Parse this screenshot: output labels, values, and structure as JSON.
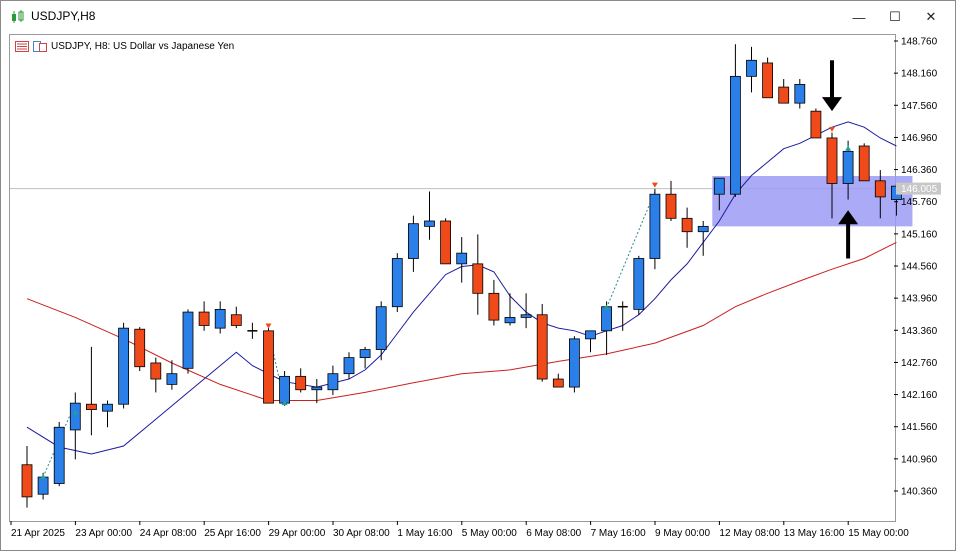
{
  "window": {
    "title": "USDJPY,H8"
  },
  "controls": {
    "minimize": "—",
    "maximize": "☐",
    "close": "✕"
  },
  "chart_header": {
    "label": "USDJPY, H8:  US Dollar vs Japanese Yen"
  },
  "colors": {
    "bull": "#2a7fe8",
    "bear": "#f04a1a",
    "ma_fast": "#1c1ca0",
    "ma_slow": "#cc1f1f",
    "zone": "#9b9bf5",
    "bid_line": "#bfbfbf"
  },
  "chart_data": {
    "type": "candlestick",
    "symbol": "USDJPY",
    "timeframe": "H8",
    "ylim": [
      139.85,
      148.9
    ],
    "y_ticks": [
      "148.760",
      "148.160",
      "147.560",
      "146.960",
      "146.360",
      "145.760",
      "145.160",
      "144.560",
      "143.960",
      "143.360",
      "142.760",
      "142.160",
      "141.560",
      "140.960",
      "140.360"
    ],
    "x_ticks": [
      {
        "label": "21 Apr 2025",
        "index": 0
      },
      {
        "label": "23 Apr 00:00",
        "index": 4
      },
      {
        "label": "24 Apr 08:00",
        "index": 8
      },
      {
        "label": "25 Apr 16:00",
        "index": 12
      },
      {
        "label": "29 Apr 00:00",
        "index": 16
      },
      {
        "label": "30 Apr 08:00",
        "index": 20
      },
      {
        "label": "1 May 16:00",
        "index": 24
      },
      {
        "label": "5 May 00:00",
        "index": 28
      },
      {
        "label": "6 May 08:00",
        "index": 32
      },
      {
        "label": "7 May 16:00",
        "index": 36
      },
      {
        "label": "9 May 00:00",
        "index": 40
      },
      {
        "label": "12 May 08:00",
        "index": 44
      },
      {
        "label": "13 May 16:00",
        "index": 48
      },
      {
        "label": "15 May 00:00",
        "index": 52
      }
    ],
    "current_price": "146.005",
    "candles": [
      [
        140.85,
        141.2,
        140.05,
        140.25
      ],
      [
        140.3,
        140.7,
        140.2,
        140.62
      ],
      [
        140.5,
        141.65,
        140.45,
        141.55
      ],
      [
        141.5,
        142.2,
        140.95,
        142.0
      ],
      [
        141.98,
        143.05,
        141.4,
        141.88
      ],
      [
        141.85,
        142.05,
        141.55,
        141.98
      ],
      [
        141.98,
        143.5,
        141.9,
        143.4
      ],
      [
        143.38,
        143.42,
        142.6,
        142.68
      ],
      [
        142.75,
        142.85,
        142.2,
        142.45
      ],
      [
        142.35,
        142.8,
        142.25,
        142.55
      ],
      [
        142.65,
        143.75,
        142.55,
        143.7
      ],
      [
        143.7,
        143.9,
        143.35,
        143.45
      ],
      [
        143.4,
        143.9,
        143.3,
        143.75
      ],
      [
        143.65,
        143.8,
        143.4,
        143.45
      ],
      [
        143.35,
        143.5,
        143.2,
        143.35
      ],
      [
        143.35,
        143.4,
        142.0,
        142.0
      ],
      [
        142.0,
        142.6,
        141.95,
        142.5
      ],
      [
        142.5,
        142.65,
        142.2,
        142.25
      ],
      [
        142.25,
        142.45,
        142.0,
        142.3
      ],
      [
        142.25,
        142.7,
        142.15,
        142.55
      ],
      [
        142.55,
        142.95,
        142.45,
        142.85
      ],
      [
        142.85,
        143.05,
        142.65,
        143.0
      ],
      [
        143.0,
        143.9,
        142.8,
        143.8
      ],
      [
        143.8,
        144.8,
        143.7,
        144.7
      ],
      [
        144.7,
        145.5,
        144.45,
        145.35
      ],
      [
        145.3,
        145.95,
        145.05,
        145.4
      ],
      [
        145.4,
        145.45,
        144.6,
        144.6
      ],
      [
        144.6,
        145.1,
        144.25,
        144.8
      ],
      [
        144.6,
        145.15,
        143.65,
        144.05
      ],
      [
        144.05,
        144.3,
        143.45,
        143.55
      ],
      [
        143.5,
        144.05,
        143.45,
        143.6
      ],
      [
        143.6,
        144.05,
        143.4,
        143.65
      ],
      [
        143.65,
        143.85,
        142.4,
        142.45
      ],
      [
        142.45,
        142.55,
        142.3,
        142.3
      ],
      [
        142.3,
        143.25,
        142.2,
        143.2
      ],
      [
        143.2,
        143.35,
        142.95,
        143.35
      ],
      [
        143.35,
        143.9,
        142.9,
        143.8
      ],
      [
        143.8,
        143.9,
        143.35,
        143.8
      ],
      [
        143.75,
        144.75,
        143.65,
        144.7
      ],
      [
        144.7,
        146.0,
        144.5,
        145.9
      ],
      [
        145.9,
        146.15,
        145.4,
        145.45
      ],
      [
        145.45,
        145.65,
        144.9,
        145.2
      ],
      [
        145.2,
        145.4,
        144.75,
        145.3
      ],
      [
        145.9,
        146.1,
        145.6,
        146.2
      ],
      [
        145.9,
        148.7,
        145.85,
        148.1
      ],
      [
        148.1,
        148.65,
        147.8,
        148.4
      ],
      [
        148.35,
        148.45,
        147.7,
        147.7
      ],
      [
        147.9,
        148.05,
        147.6,
        147.6
      ],
      [
        147.6,
        148.05,
        147.5,
        147.95
      ],
      [
        147.45,
        147.5,
        146.95,
        146.95
      ],
      [
        146.95,
        147.05,
        145.45,
        146.1
      ],
      [
        146.1,
        146.9,
        145.8,
        146.7
      ],
      [
        146.8,
        146.85,
        146.15,
        146.15
      ],
      [
        146.15,
        146.35,
        145.45,
        145.85
      ],
      [
        145.8,
        146.1,
        145.5,
        146.05
      ]
    ],
    "ma_fast": [
      [
        0,
        141.55
      ],
      [
        2,
        141.18
      ],
      [
        4,
        141.05
      ],
      [
        6,
        141.2
      ],
      [
        8,
        141.7
      ],
      [
        10,
        142.2
      ],
      [
        12,
        142.7
      ],
      [
        13,
        142.95
      ],
      [
        14,
        142.7
      ],
      [
        16,
        142.4
      ],
      [
        18,
        142.3
      ],
      [
        20,
        142.45
      ],
      [
        21,
        142.62
      ],
      [
        22,
        142.9
      ],
      [
        23,
        143.3
      ],
      [
        24,
        143.7
      ],
      [
        25,
        144.05
      ],
      [
        26,
        144.4
      ],
      [
        27,
        144.55
      ],
      [
        28,
        144.58
      ],
      [
        29,
        144.45
      ],
      [
        30,
        144.0
      ],
      [
        31,
        143.7
      ],
      [
        32,
        143.5
      ],
      [
        33,
        143.4
      ],
      [
        34,
        143.35
      ],
      [
        35,
        143.25
      ],
      [
        36,
        143.35
      ],
      [
        37,
        143.45
      ],
      [
        38,
        143.65
      ],
      [
        39,
        143.95
      ],
      [
        40,
        144.3
      ],
      [
        41,
        144.6
      ],
      [
        42,
        145.0
      ],
      [
        43,
        145.4
      ],
      [
        44,
        145.9
      ],
      [
        45,
        146.25
      ],
      [
        46,
        146.5
      ],
      [
        47,
        146.75
      ],
      [
        48,
        146.85
      ],
      [
        49,
        147.0
      ],
      [
        50,
        147.15
      ],
      [
        51,
        147.25
      ],
      [
        52,
        147.15
      ],
      [
        53,
        146.95
      ],
      [
        54,
        146.8
      ]
    ],
    "ma_slow": [
      [
        0,
        143.95
      ],
      [
        3,
        143.6
      ],
      [
        6,
        143.2
      ],
      [
        9,
        142.75
      ],
      [
        12,
        142.35
      ],
      [
        15,
        142.05
      ],
      [
        18,
        142.05
      ],
      [
        21,
        142.2
      ],
      [
        24,
        142.38
      ],
      [
        27,
        142.55
      ],
      [
        30,
        142.62
      ],
      [
        33,
        142.78
      ],
      [
        36,
        142.92
      ],
      [
        39,
        143.12
      ],
      [
        42,
        143.45
      ],
      [
        44,
        143.8
      ],
      [
        46,
        144.05
      ],
      [
        48,
        144.28
      ],
      [
        50,
        144.5
      ],
      [
        52,
        144.7
      ],
      [
        54,
        145.0
      ]
    ],
    "zone": {
      "from_index": 43,
      "to_index": 54.5,
      "top": 146.24,
      "bottom": 145.3
    },
    "dotted_connectors": [
      {
        "from": [
          1,
          140.62
        ],
        "to": [
          3,
          142.0
        ]
      },
      {
        "from": [
          15,
          143.35
        ],
        "to": [
          16,
          142.0
        ]
      },
      {
        "from": [
          36,
          143.78
        ],
        "to": [
          39,
          145.95
        ]
      }
    ],
    "signal_markers": [
      {
        "index": 1,
        "price": 140.62,
        "kind": "buy"
      },
      {
        "index": 3,
        "price": 141.82,
        "kind": "buy"
      },
      {
        "index": 15,
        "price": 143.45,
        "kind": "sell"
      },
      {
        "index": 16,
        "price": 142.0,
        "kind": "buy"
      },
      {
        "index": 36,
        "price": 143.78,
        "kind": "buy"
      },
      {
        "index": 39,
        "price": 146.08,
        "kind": "sell"
      },
      {
        "index": 50,
        "price": 147.12,
        "kind": "sell"
      },
      {
        "index": 51,
        "price": 146.75,
        "kind": "buy"
      }
    ],
    "annotations": [
      {
        "kind": "arrow-down",
        "index": 50,
        "from": 148.4,
        "to": 147.45
      },
      {
        "kind": "arrow-up",
        "index": 51,
        "from": 144.7,
        "to": 145.6
      }
    ]
  }
}
